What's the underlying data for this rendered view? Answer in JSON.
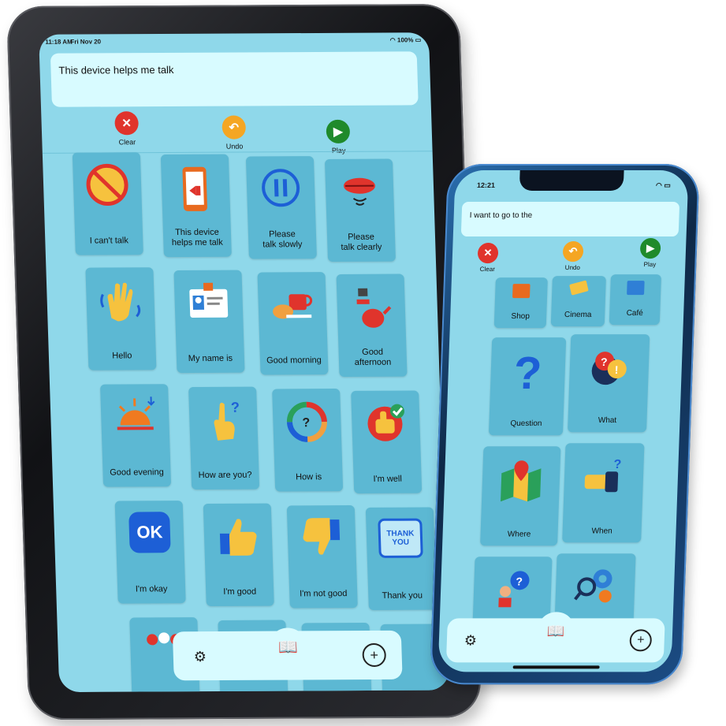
{
  "tablet": {
    "status": {
      "time": "11:18 AM",
      "date": "Fri Nov 20",
      "battery": "100%"
    },
    "message": "This device helps me talk",
    "controls": {
      "clear": "Clear",
      "undo": "Undo",
      "play": "Play"
    },
    "tiles": [
      "I can't talk",
      "This device\nhelps me talk",
      "Please\ntalk slowly",
      "Please\ntalk clearly",
      "Hello",
      "My name is",
      "Good morning",
      "Good\nafternoon",
      "Good evening",
      "How are you?",
      "How is",
      "I'm well",
      "I'm okay",
      "I'm good",
      "I'm not good",
      "Thank you"
    ],
    "ok_badge": "OK",
    "thank_badge": "THANK\nYOU"
  },
  "phone": {
    "status": {
      "time": "12:21"
    },
    "message": "I want to go to the",
    "controls": {
      "clear": "Clear",
      "undo": "Undo",
      "play": "Play"
    },
    "tiles": [
      "Shop",
      "Cinema",
      "Café",
      "Question",
      "What",
      "Where",
      "When"
    ]
  },
  "colors": {
    "screen": "#8fd8ea",
    "tile": "#5cb8d3",
    "panel": "#d8fbff",
    "clear": "#e0342c",
    "undo": "#f5a623",
    "play": "#1f8a2b"
  }
}
